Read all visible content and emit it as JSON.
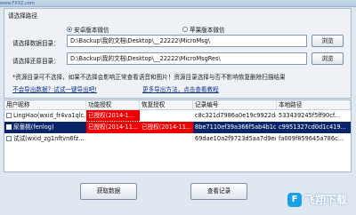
{
  "window": {
    "title": "",
    "watermark_top": "www.FXXZ.com"
  },
  "source_group": {
    "title": "请选择路径",
    "radio_android": "安卓版本微信",
    "radio_ios": "苹果版本微信",
    "data_dir_label": "请选择数据目录：",
    "data_dir_value": "D:\\Backup\\我的文档\\Desktop\\__22222\\MicroMsg\\",
    "restore_dir_label": "请选择还原目录：",
    "restore_dir_value": "D:\\Backup\\我的文档\\Desktop\\__22222\\MicroMsgRes\\",
    "browse_label": "浏览",
    "note": "*资源目录可不选择，如果不选择会影响正常查看语音和图片！资源目录选择与否不影响恢复删除扫描结果",
    "link_how_export": "不会导出数据？试试一键导出吧!",
    "link_more_methods": "更多导出方法，点击查看教程"
  },
  "table": {
    "columns": [
      "用户昵称",
      "功能授权",
      "恢复授权",
      "记录编号",
      "本地路径"
    ],
    "rows": [
      {
        "nickname": "LingHao(wxid_fr4va1qlc...",
        "func_auth": "已授权(2014-1...",
        "restore_auth": "",
        "record": "c8c321d7986a0e19c9922da70...",
        "path": "533439245f5ff90cf...",
        "selected": false
      },
      {
        "nickname": "尿童桃(fenlog)",
        "func_auth": "已授权(2014-11...",
        "restore_auth": "已授权(2014-11...",
        "record": "8be7110ef39a366f5ab4b1c86b...",
        "path": "c9951327cd0d1c419...",
        "selected": true
      },
      {
        "nickname": "试试(wxid_zg1nftvn6fz...",
        "func_auth": "",
        "restore_auth": "",
        "record": "69dae10a2f9723d5aa7d9eccc7...",
        "path": "fa009f859645a786c...",
        "selected": false
      }
    ]
  },
  "buttons": {
    "fetch": "获取数据",
    "view": "查看记录"
  },
  "watermark": {
    "badge": "F",
    "text": "飞翔下载"
  }
}
